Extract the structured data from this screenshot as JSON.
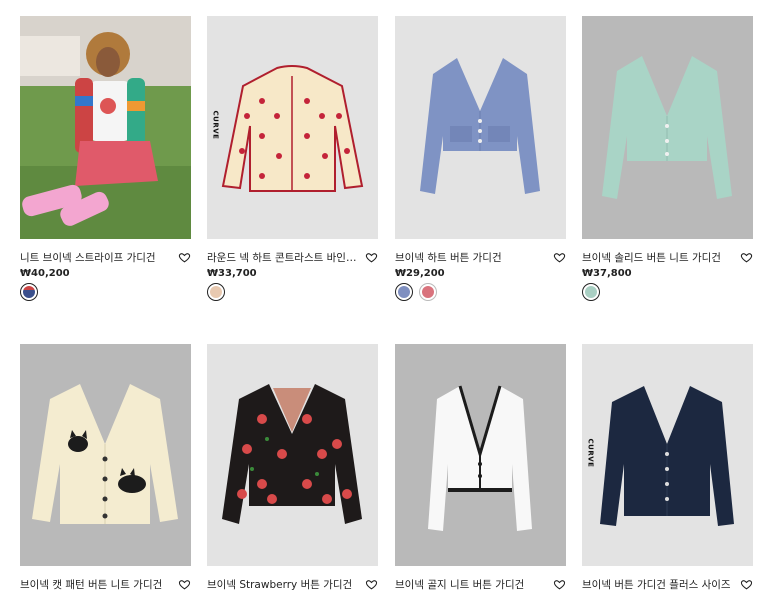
{
  "products": [
    {
      "name": "니트 브이넥 스트라이프 가디건",
      "price": "₩40,200",
      "swatches": [
        "#3a4f8c"
      ]
    },
    {
      "name": "라운드 넥 하트 콘트라스트 바인딩 가디건",
      "price": "₩33,700",
      "swatches": [
        "#e8c9b0"
      ],
      "curve_label": "CURVE"
    },
    {
      "name": "브이넥 하트 버튼 가디건",
      "price": "₩29,200",
      "swatches": [
        "#7f8fc0",
        "#d9737d"
      ]
    },
    {
      "name": "브이넥 솔리드 버튼 니트 가디건",
      "price": "₩37,800",
      "swatches": [
        "#a9cfc3"
      ]
    },
    {
      "name": "브이넥 캣 패턴 버튼 니트 가디건"
    },
    {
      "name": "브이넥 Strawberry 버튼 가디건"
    },
    {
      "name": "브이넥 골지 니트 버튼 가디건"
    },
    {
      "name": "브이넥 버튼 가디건 플러스 사이즈",
      "curve_label": "CURVE"
    }
  ]
}
